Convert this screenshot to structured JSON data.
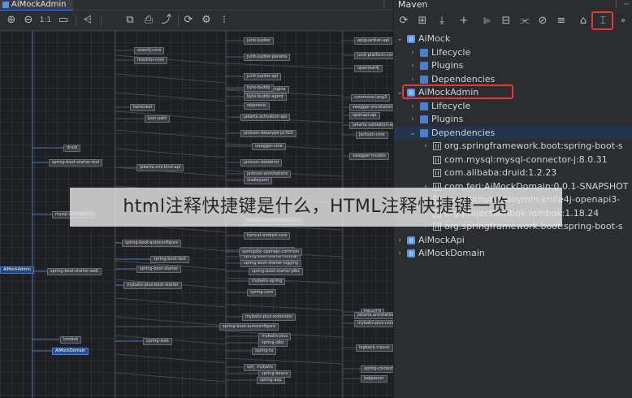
{
  "editor": {
    "tab_title": "AiMockAdmin",
    "tab_more": "⋮",
    "toolbar": {
      "zoom_in": "⊕",
      "zoom_out": "⊖",
      "actual_size": "1:1",
      "fit": "▭",
      "share": "⩤",
      "copy": "⧉",
      "export": "⎙",
      "jump": "⤴",
      "refresh": "⟳",
      "settings": "⚙",
      "layout": "⁝"
    }
  },
  "diagram": {
    "nodes": [
      "druid",
      "spring-boot-starter-test",
      "mysql-connector-j",
      "AiMockAdmin",
      "spring-boot-starter-web",
      "lombok",
      "AiMockDomain",
      "spring-web",
      "spring-boot-autoconfigure",
      "spring-boot-test",
      "spring-boot-starter",
      "mybatis-plus-boot-starter",
      "jakarta.xml.bind-api",
      "json-path",
      "assertj-core",
      "mockito-core",
      "hamcrest",
      "junit-jupiter",
      "junit-jupiter-params",
      "junit-jupiter-api",
      "junit-jupiter-engine",
      "byte-buddy",
      "byte-buddy-agent",
      "objenesis",
      "jakarta.activation-api",
      "jackson-datatype-jsr310",
      "swagger-core",
      "jackson-databind",
      "jackson-annotations",
      "snakeyaml",
      "spring-boot-starter-logging",
      "spring-boot-starter-json",
      "tomcat-embed-core",
      "spring-boot-starter-tomcat",
      "tomcat-embed-websocket",
      "springdoc-openapi-common",
      "mybatis-spring",
      "spring-boot-starter-jdbc",
      "spring-core",
      "spring-jcl",
      "HikariCP",
      "mybatis-plus",
      "spring-tx",
      "spring-jdbc",
      "spring-beans",
      "spring-aop",
      "jsqlparser",
      "spring-context",
      "logback-classic",
      "mybatis",
      "apiguardian-api",
      "junit-platform-commons",
      "opentest4j",
      "commons-lang3",
      "swagger-annotations",
      "openapi-api",
      "jakarta.validation-api",
      "jackson-core",
      "swagger-models",
      "jakarta.annotation-api",
      "mybatis-plus-core",
      "spring-boot-autoconfigure-2",
      "mybatis-plus-extension"
    ]
  },
  "maven": {
    "title": "Maven",
    "title_icons": "⋮ −",
    "toolbar": {
      "reload": "⟳",
      "add_module": "⊞",
      "download": "⤓",
      "add": "+",
      "run": "▶",
      "execute_goal": "⊟",
      "toggle_offline": "⫘",
      "skip_tests": "⊘",
      "collapse": "≡",
      "analyze": "⌂",
      "show_dependencies": "⌶",
      "more": "»"
    },
    "tree": [
      {
        "level": 0,
        "arrow": "⌄",
        "icon": "module",
        "label": "AiMock"
      },
      {
        "level": 1,
        "arrow": "›",
        "icon": "folder",
        "label": "Lifecycle"
      },
      {
        "level": 1,
        "arrow": "›",
        "icon": "folder",
        "label": "Plugins"
      },
      {
        "level": 1,
        "arrow": "›",
        "icon": "folder",
        "label": "Dependencies"
      },
      {
        "level": 0,
        "arrow": "⌄",
        "icon": "module",
        "label": "AiMockAdmin"
      },
      {
        "level": 1,
        "arrow": "›",
        "icon": "folder",
        "label": "Lifecycle"
      },
      {
        "level": 1,
        "arrow": "›",
        "icon": "folder",
        "label": "Plugins"
      },
      {
        "level": 1,
        "arrow": "⌄",
        "icon": "folder",
        "label": "Dependencies"
      },
      {
        "level": 2,
        "arrow": "›",
        "icon": "lib",
        "label": "org.springframework.boot:spring-boot-s"
      },
      {
        "level": 2,
        "arrow": "",
        "icon": "lib",
        "label": "com.mysql:mysql-connector-j:8.0.31"
      },
      {
        "level": 2,
        "arrow": "",
        "icon": "lib",
        "label": "com.alibaba:druid:1.2.23"
      },
      {
        "level": 2,
        "arrow": "›",
        "icon": "lib",
        "label": "com.feri:AiMockDomain:0.0.1-SNAPSHOT"
      },
      {
        "level": 2,
        "arrow": "›",
        "icon": "lib",
        "label": "com.github.xiaoymin:knife4j-openapi3-"
      },
      {
        "level": 2,
        "arrow": "",
        "icon": "lib",
        "label": "org.projectlombok:lombok:1.18.24"
      },
      {
        "level": 2,
        "arrow": "›",
        "icon": "lib",
        "label": "org.springframework.boot:spring-boot-s"
      },
      {
        "level": 0,
        "arrow": "›",
        "icon": "module",
        "label": "AiMockApi"
      },
      {
        "level": 0,
        "arrow": "›",
        "icon": "module",
        "label": "AiMockDomain"
      }
    ]
  },
  "watermark": {
    "text": "html注释快捷键是什么，HTML注释快捷键一览"
  },
  "colors": {
    "highlight_box": "#e53935",
    "selection": "#23344d",
    "accent": "#3574f0"
  }
}
